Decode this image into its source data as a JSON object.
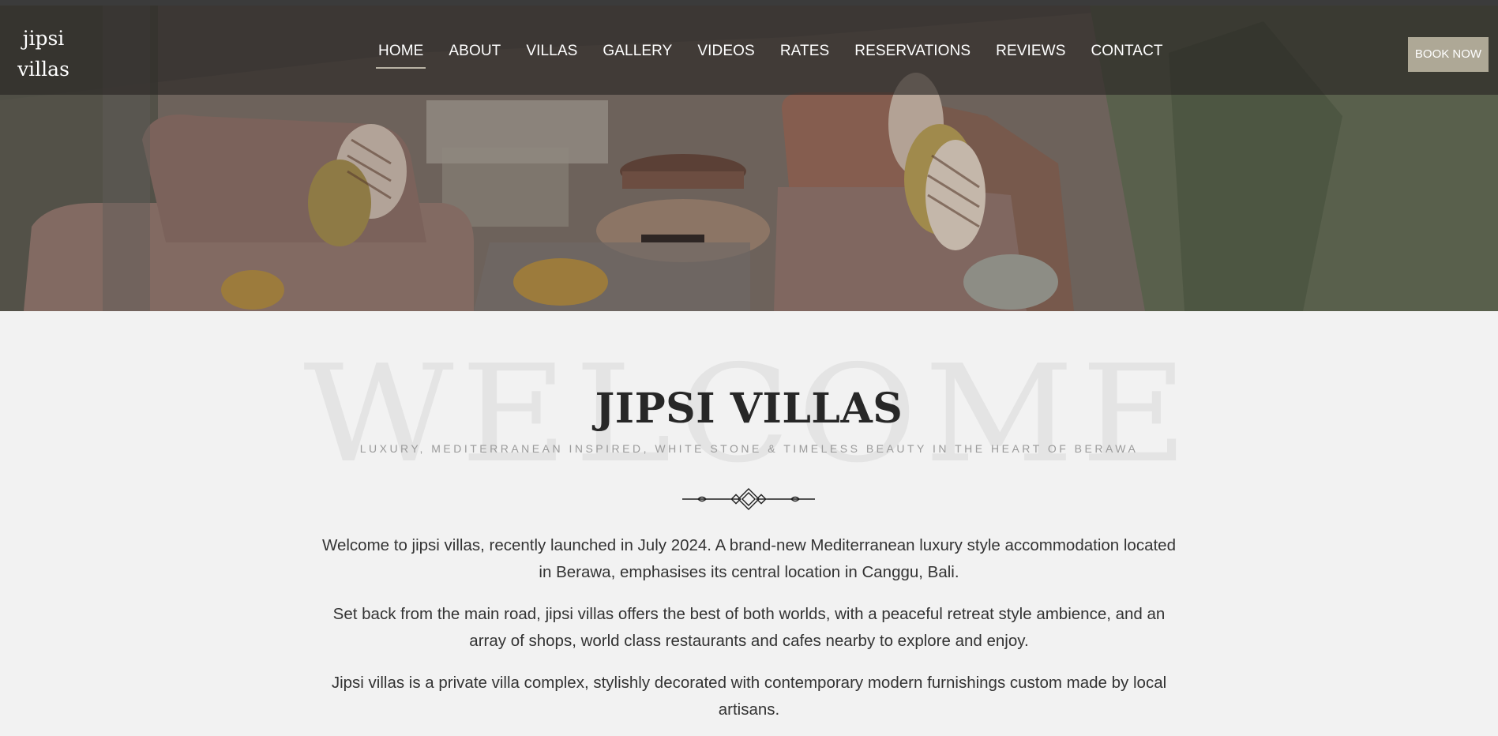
{
  "logo": {
    "line1": "jipsi",
    "line2": "villas"
  },
  "nav": {
    "items": [
      {
        "label": "HOME",
        "active": true
      },
      {
        "label": "ABOUT"
      },
      {
        "label": "VILLAS"
      },
      {
        "label": "GALLERY"
      },
      {
        "label": "VIDEOS"
      },
      {
        "label": "RATES"
      },
      {
        "label": "RESERVATIONS"
      },
      {
        "label": "REVIEWS"
      },
      {
        "label": "CONTACT"
      }
    ]
  },
  "book_now": "BOOK NOW",
  "welcome": {
    "background_word": "WELCOME",
    "title": "JIPSI VILLAS",
    "subtitle": "LUXURY, MEDITERRANEAN INSPIRED, WHITE STONE & TIMELESS BEAUTY IN THE HEART OF BERAWA",
    "paragraphs": [
      "Welcome to jipsi villas, recently launched in July 2024. A brand-new Mediterranean luxury style accommodation located in Berawa, emphasises its central location in Canggu, Bali.",
      "Set back from the main road, jipsi villas offers the best of both worlds, with a peaceful retreat style ambience, and an array of shops, world class restaurants and cafes nearby to explore and enjoy.",
      "Jipsi villas is a private villa complex, stylishly decorated with contemporary modern furnishings custom made by local artisans."
    ]
  },
  "colors": {
    "accent": "#aea896",
    "title": "#272727",
    "subtitle": "#9a9a9a",
    "body_text": "#333333",
    "page_bg": "#f2f2f2"
  },
  "icons": {
    "ornament": "divider-ornament-icon"
  }
}
